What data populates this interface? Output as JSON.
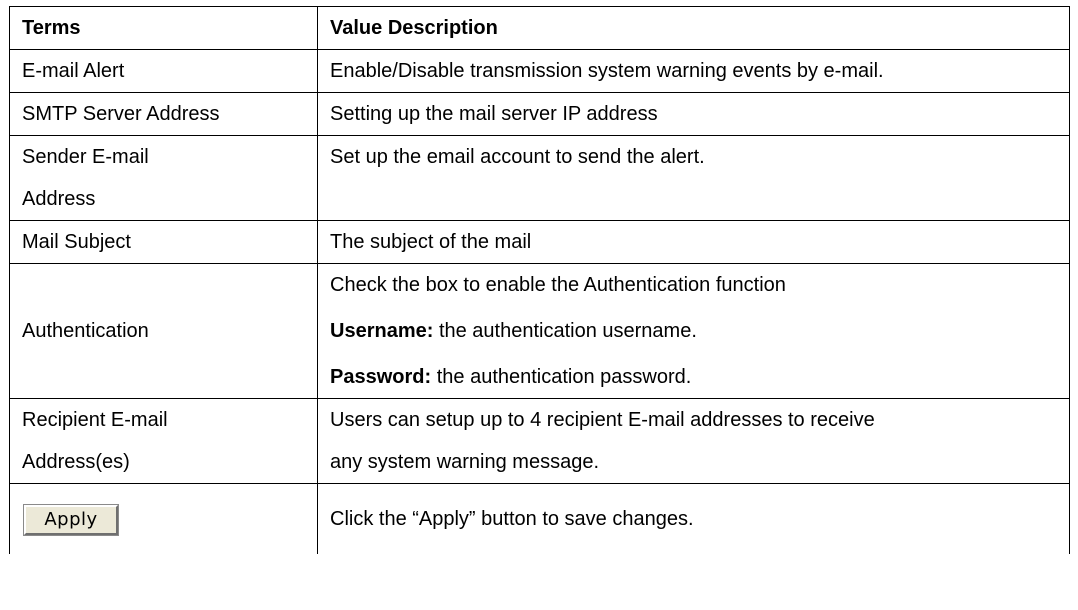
{
  "table": {
    "header": {
      "terms": "Terms",
      "value_description": "Value Description"
    },
    "rows": [
      {
        "term": "E-mail Alert",
        "description": "Enable/Disable transmission system warning events by e-mail."
      },
      {
        "term": "SMTP Server Address",
        "description": "Setting up the mail server IP address"
      },
      {
        "term_line1": "Sender E-mail",
        "term_line2": "Address",
        "description": "Set up the email account to send the alert."
      },
      {
        "term": "Mail Subject",
        "description": "The subject of the mail"
      },
      {
        "term": "Authentication",
        "description_line1": "Check the box to enable the Authentication function",
        "username_label": "Username:",
        "username_text": " the authentication username.",
        "password_label": "Password:",
        "password_text": " the authentication password."
      },
      {
        "term_line1": "Recipient E-mail",
        "term_line2": "Address(es)",
        "description_line1": "Users can setup up to 4 recipient E-mail addresses to receive",
        "description_line2": "any system warning message."
      },
      {
        "button_label": "Apply",
        "description": "Click the “Apply” button to save changes."
      }
    ]
  }
}
